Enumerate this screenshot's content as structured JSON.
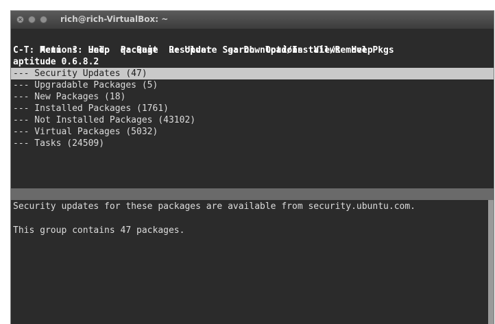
{
  "window": {
    "title": "rich@rich-VirtualBox: ~"
  },
  "menu": [
    "Actions",
    "Undo",
    "Package",
    "Resolver",
    "Search",
    "Options",
    "Views",
    "Help"
  ],
  "help_line": "C-T: Menu  ?: Help  q: Quit  u: Update  g: Download/Install/Remove Pkgs",
  "version": "aptitude 0.6.8.2",
  "groups": [
    "--- Security Updates (47)",
    "--- Upgradable Packages (5)",
    "--- New Packages (18)",
    "--- Installed Packages (1761)",
    "--- Not Installed Packages (43102)",
    "--- Virtual Packages (5032)",
    "--- Tasks (24509)"
  ],
  "info": {
    "line1": "Security updates for these packages are available from security.ubuntu.com.",
    "line2": "This group contains 47 packages."
  }
}
